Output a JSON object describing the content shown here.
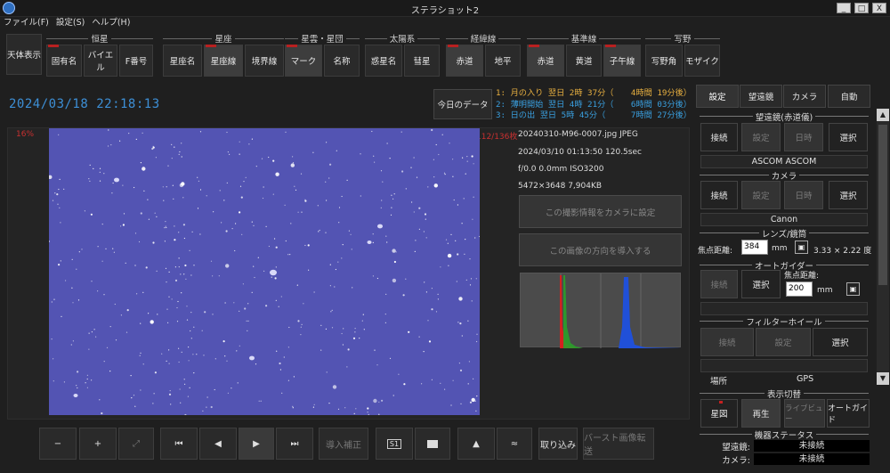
{
  "window": {
    "title": "ステラショット2",
    "minimize": "_",
    "maximize": "□",
    "close": "X"
  },
  "menu": [
    "ファイル(F)",
    "設定(S)",
    "ヘルプ(H)"
  ],
  "toolbar": {
    "celestial_display": "天体表示",
    "groups": [
      {
        "name": "恒星",
        "buttons": [
          {
            "label": "固有名",
            "on": false,
            "red": true
          },
          {
            "label": "バイエル",
            "on": false,
            "red": false
          },
          {
            "label": "F番号",
            "on": false,
            "red": false
          }
        ]
      },
      {
        "name": "星座",
        "buttons": [
          {
            "label": "星座名",
            "on": false,
            "red": false
          },
          {
            "label": "星座線",
            "on": true,
            "red": true
          },
          {
            "label": "境界線",
            "on": false,
            "red": false
          }
        ]
      },
      {
        "name": "星雲・星団",
        "buttons": [
          {
            "label": "マーク",
            "on": true,
            "red": true
          },
          {
            "label": "名称",
            "on": false,
            "red": false
          }
        ]
      },
      {
        "name": "太陽系",
        "buttons": [
          {
            "label": "惑星名",
            "on": false,
            "red": false
          },
          {
            "label": "彗星",
            "on": false,
            "red": false
          }
        ]
      },
      {
        "name": "経緯線",
        "buttons": [
          {
            "label": "赤道",
            "on": true,
            "red": true
          },
          {
            "label": "地平",
            "on": false,
            "red": false
          }
        ]
      },
      {
        "name": "基準線",
        "buttons": [
          {
            "label": "赤道",
            "on": true,
            "red": true
          },
          {
            "label": "黄道",
            "on": false,
            "red": false
          },
          {
            "label": "子午線",
            "on": true,
            "red": true
          }
        ]
      },
      {
        "name": "写野",
        "buttons": [
          {
            "label": "写野角",
            "on": false,
            "red": false
          },
          {
            "label": "モザイク",
            "on": false,
            "red": false
          }
        ]
      }
    ]
  },
  "datetime": "2024/03/18  22:18:13",
  "today_button": "今日のデータ",
  "events": [
    {
      "a": "1: 月の入り 翌日 2時 37分（",
      "b": " 4時間 19分後）",
      "color": "#e8b040"
    },
    {
      "a": "2: 薄明開始 翌日 4時 21分（",
      "b": " 6時間 03分後）",
      "color": "#3aa0e0"
    },
    {
      "a": "3: 日の出 翌日 5時 45分（",
      "b": " 7時間 27分後）",
      "color": "#3aa0e0"
    }
  ],
  "image": {
    "zoom": "16%",
    "frame_counter": "112/136枚",
    "filename": "20240310-M96-0007.jpg JPEG",
    "capture": "2024/03/10 01:13:50 120.5sec",
    "lens": "f/0.0 0.0mm ISO3200",
    "size": "5472×3648 7,904KB",
    "set_camera_button": "この撮影情報をカメラに設定",
    "import_direction_button": "この画像の方向を導入する",
    "histogram_colors": {
      "red": "#d42020",
      "green": "#2aa02a",
      "blue": "#2050d8"
    }
  },
  "bottom": {
    "zoom_out": "−",
    "zoom_in": "+",
    "fit": "⤢",
    "first": "⏮",
    "prev": "◀",
    "play": "▶",
    "last": "⏭",
    "import_correct": "導入補正",
    "s1": "S1",
    "folder": "folder",
    "chart": "▲",
    "graph": "≈",
    "capture_in": "取り込み",
    "burst_transfer": "バースト画像転送"
  },
  "right": {
    "tabs": [
      "設定",
      "望遠鏡",
      "カメラ",
      "自動"
    ],
    "telescope_header": "望遠鏡(赤道儀)",
    "telescope_buttons": {
      "connect": "接続",
      "settings": "設定",
      "datetime": "日時",
      "select": "選択"
    },
    "telescope_name": "ASCOM ASCOM",
    "camera_header": "カメラ",
    "camera_buttons": {
      "connect": "接続",
      "settings": "設定",
      "datetime": "日時",
      "select": "選択"
    },
    "camera_name": "Canon",
    "lens_header": "レンズ/鏡筒",
    "focal_label": "焦点距離:",
    "focal_value": "384",
    "focal_unit": "mm",
    "fov": "3.33 × 2.22 度",
    "autoguider_header": "オートガイダー",
    "ag_connect": "接続",
    "ag_select": "選択",
    "ag_focal_label": "焦点距離:",
    "ag_focal_value": "200",
    "ag_focal_unit": "mm",
    "filter_header": "フィルターホイール",
    "fw_connect": "接続",
    "fw_settings": "設定",
    "fw_select": "選択",
    "location_label": "場所",
    "gps_label": "GPS",
    "display_switch_header": "表示切替",
    "display_buttons": [
      "星図",
      "再生",
      "ライブビュー",
      "オートガイド"
    ],
    "status_header": "機器ステータス",
    "status": [
      {
        "k": "望遠鏡:",
        "v": "未接続"
      },
      {
        "k": "カメラ:",
        "v": "未接続"
      }
    ]
  }
}
